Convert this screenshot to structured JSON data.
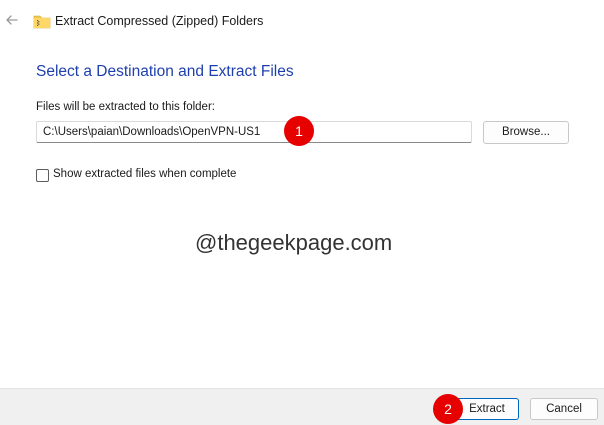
{
  "window": {
    "title": "Extract Compressed (Zipped) Folders",
    "back_icon": "back-arrow-icon",
    "app_icon": "zipped-folder-icon"
  },
  "main": {
    "heading": "Select a Destination and Extract Files",
    "path_label": "Files will be extracted to this folder:",
    "path_value": "C:\\Users\\paian\\Downloads\\OpenVPN-US1",
    "browse_label": "Browse...",
    "show_files_label": "Show extracted files when complete",
    "show_files_checked": false
  },
  "watermark": "@thegeekpage.com",
  "annotations": {
    "badge_1": "1",
    "badge_2": "2",
    "badge_color": "#e60000"
  },
  "footer": {
    "extract_label": "Extract",
    "cancel_label": "Cancel"
  },
  "colors": {
    "heading": "#1e3fae",
    "accent": "#0067c0"
  }
}
